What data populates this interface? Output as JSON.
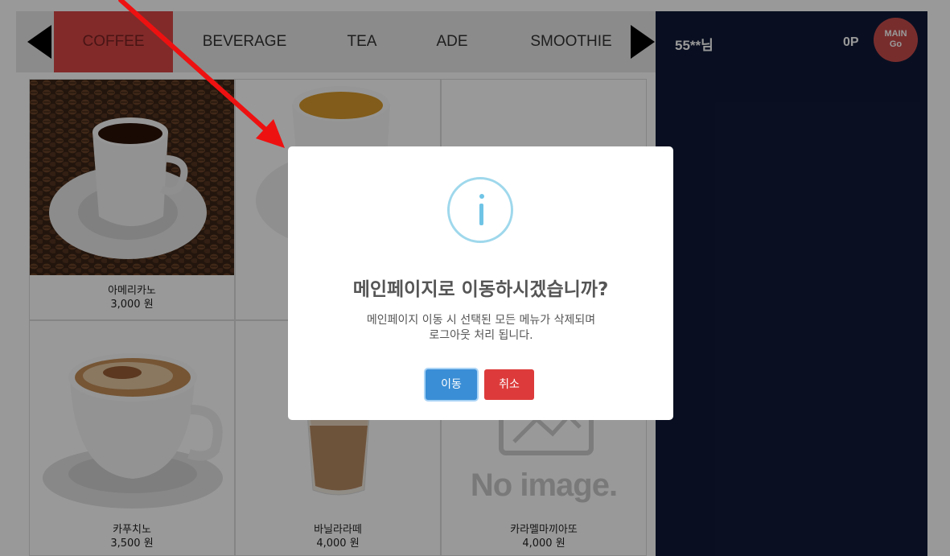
{
  "categories": {
    "tabs": [
      {
        "label": "COFFEE",
        "active": true
      },
      {
        "label": "BEVERAGE"
      },
      {
        "label": "TEA"
      },
      {
        "label": "ADE"
      },
      {
        "label": "SMOOTHIE"
      }
    ]
  },
  "side": {
    "user": "55**님",
    "points": "0P",
    "main_button": {
      "line1": "MAIN",
      "line2": "Go"
    }
  },
  "products": [
    {
      "name": "아메리카노",
      "price": "3,000 원"
    },
    {
      "name": "",
      "price": ""
    },
    {
      "name": "",
      "price": ""
    },
    {
      "name": "카푸치노",
      "price": "3,500 원"
    },
    {
      "name": "바닐라라떼",
      "price": "4,000 원"
    },
    {
      "name": "카라멜마끼아또",
      "price": "4,000 원"
    }
  ],
  "no_image_text": "No image.",
  "modal": {
    "title": "메인페이지로 이동하시겠습니까?",
    "message": "메인페이지 이동 시 선택된 모든 메뉴가 삭제되며\n로그아웃 처리 됩니다.",
    "confirm": "이동",
    "cancel": "취소"
  },
  "colors": {
    "active_tab": "#d94646",
    "side_panel": "#101a38",
    "main_button": "#c94b4b",
    "confirm": "#3a8ed6",
    "cancel": "#dd3b3b",
    "annotation": "#ee1111"
  }
}
